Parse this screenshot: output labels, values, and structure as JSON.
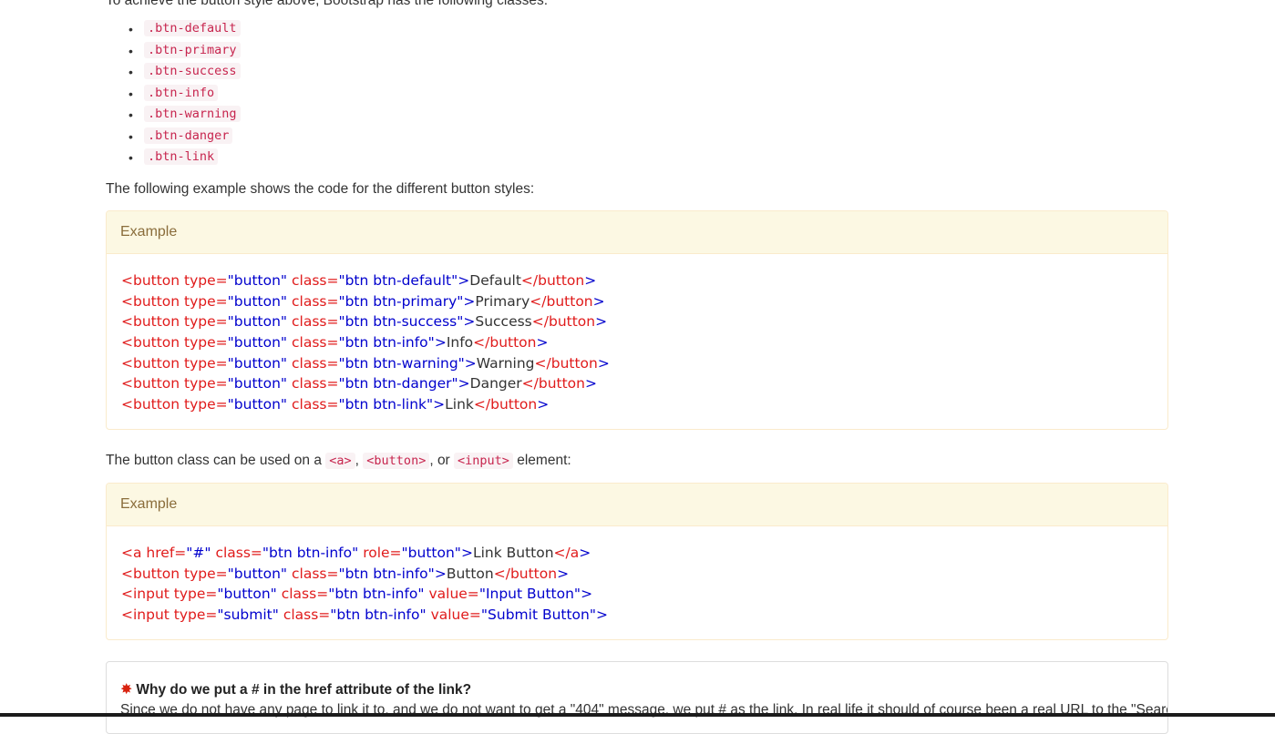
{
  "intro_text": "To achieve the button style above, Bootstrap has the following classes:",
  "class_list": [
    ".btn-default",
    ".btn-primary",
    ".btn-success",
    ".btn-info",
    ".btn-warning",
    ".btn-danger",
    ".btn-link"
  ],
  "example1_intro": "The following example shows the code for the different button styles:",
  "example1": {
    "heading": "Example",
    "lines": [
      {
        "open": "<button",
        "a1": " type=",
        "v1": "\"button\"",
        "a2": " class=",
        "v2": "\"btn btn-default\"",
        "gt": ">",
        "text": "Default",
        "close": "</button",
        "end": ">"
      },
      {
        "open": "<button",
        "a1": " type=",
        "v1": "\"button\"",
        "a2": " class=",
        "v2": "\"btn btn-primary\"",
        "gt": ">",
        "text": "Primary",
        "close": "</button",
        "end": ">"
      },
      {
        "open": "<button",
        "a1": " type=",
        "v1": "\"button\"",
        "a2": " class=",
        "v2": "\"btn btn-success\"",
        "gt": ">",
        "text": "Success",
        "close": "</button",
        "end": ">"
      },
      {
        "open": "<button",
        "a1": " type=",
        "v1": "\"button\"",
        "a2": " class=",
        "v2": "\"btn btn-info\"",
        "gt": ">",
        "text": "Info",
        "close": "</button",
        "end": ">"
      },
      {
        "open": "<button",
        "a1": " type=",
        "v1": "\"button\"",
        "a2": " class=",
        "v2": "\"btn btn-warning\"",
        "gt": ">",
        "text": "Warning",
        "close": "</button",
        "end": ">"
      },
      {
        "open": "<button",
        "a1": " type=",
        "v1": "\"button\"",
        "a2": " class=",
        "v2": "\"btn btn-danger\"",
        "gt": ">",
        "text": "Danger",
        "close": "</button",
        "end": ">"
      },
      {
        "open": "<button",
        "a1": " type=",
        "v1": "\"button\"",
        "a2": " class=",
        "v2": "\"btn btn-link\"",
        "gt": ">",
        "text": "Link",
        "close": "</button",
        "end": ">"
      }
    ]
  },
  "example2_intro": {
    "before": "The button class can be used on a ",
    "code_a": "<a>",
    "sep1": ", ",
    "code_button": "<button>",
    "sep2": ", or ",
    "code_input": "<input>",
    "after": " element:"
  },
  "example2": {
    "heading": "Example",
    "line1": {
      "open": "<a",
      "a1": " href=",
      "v1": "\"#\"",
      "a2": " class=",
      "v2": "\"btn btn-info\"",
      "a3": " role=",
      "v3": "\"button\"",
      "gt": ">",
      "text": "Link Button",
      "close": "</a",
      "end": ">"
    },
    "line2": {
      "open": "<button",
      "a1": " type=",
      "v1": "\"button\"",
      "a2": " class=",
      "v2": "\"btn btn-info\"",
      "gt": ">",
      "text": "Button",
      "close": "</button",
      "end": ">"
    },
    "line3": {
      "open": "<input",
      "a1": " type=",
      "v1": "\"button\"",
      "a2": " class=",
      "v2": "\"btn btn-info\"",
      "a3": " value=",
      "v3": "\"Input Button\"",
      "end": ">"
    },
    "line4": {
      "open": "<input",
      "a1": " type=",
      "v1": "\"submit\"",
      "a2": " class=",
      "v2": "\"btn btn-info\"",
      "a3": " value=",
      "v3": "\"Submit Button\"",
      "end": ">"
    }
  },
  "note": {
    "star": "✸",
    "title": "Why do we put a # in the href attribute of the link?",
    "body": "Since we do not have any page to link it to, and we do not want to get a \"404\" message, we put # as the link. In real life it should of course been a real URL to the \"Search\" page."
  },
  "colors": {
    "tag": "#e01b1b",
    "value": "#0000cd",
    "code_bg": "#f9f2f4",
    "code_fg": "#c7254e",
    "panel_heading_bg": "#fcf8e3",
    "panel_border": "#faebcc",
    "note_star": "#d9230f"
  }
}
